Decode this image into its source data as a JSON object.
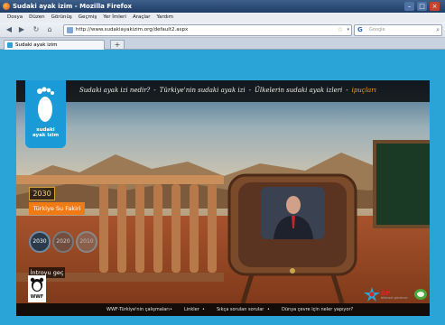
{
  "window": {
    "title": "Sudaki ayak izim - Mozilla Firefox"
  },
  "menu": [
    "Dosya",
    "Düzen",
    "Görünüş",
    "Geçmiş",
    "Yer İmleri",
    "Araçlar",
    "Yardım"
  ],
  "nav": {
    "url": "http://www.sudakiayakizim.org/default2.aspx",
    "search_placeholder": "Google"
  },
  "tabs": [
    {
      "label": "Sudaki ayak izim"
    }
  ],
  "site": {
    "logo_text_1": "sudaki",
    "logo_text_2": "ayak izim",
    "nav": [
      "Sudaki ayak izi nedir?",
      "Türkiye'nin sudaki ayak izi",
      "Ülkelerin sudaki ayak izleri",
      "ipuçları"
    ],
    "year_label": "2030",
    "water_title": "Türkiye Su Fakiri",
    "year_buttons": [
      "2030",
      "2020",
      "2010"
    ],
    "intro_button": "İntroyu geç",
    "footer_links": [
      "WWF-Türkiye'nin çalışmaları",
      "Linkler",
      "Sıkça sorulan sorular",
      "Dünya çevre için neler yapıyor?"
    ],
    "wwf": "WWF",
    "partner": "BP",
    "partner_sub": "bilimsel güvence"
  }
}
